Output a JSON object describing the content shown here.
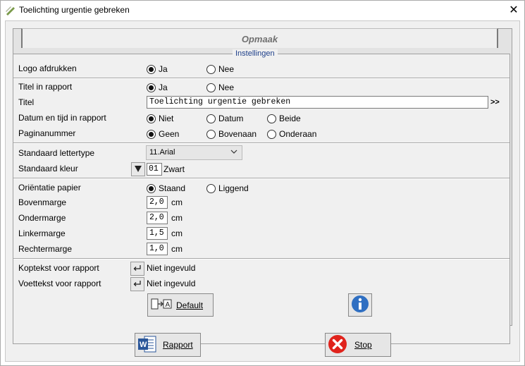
{
  "window": {
    "title": "Toelichting urgentie gebreken",
    "close": "✕"
  },
  "tab": {
    "label": "Opmaak"
  },
  "group": {
    "legend": "Instellingen"
  },
  "logo": {
    "label": "Logo afdrukken",
    "opt1": "Ja",
    "opt2": "Nee",
    "selected": "Ja"
  },
  "title_in_report": {
    "label": "Titel in rapport",
    "opt1": "Ja",
    "opt2": "Nee",
    "selected": "Ja"
  },
  "title": {
    "label": "Titel",
    "value": "Toelichting urgentie gebreken",
    "more": ">>"
  },
  "datetime": {
    "label": "Datum en tijd in rapport",
    "opt1": "Niet",
    "opt2": "Datum",
    "opt3": "Beide",
    "selected": "Niet"
  },
  "pagenum": {
    "label": "Paginanummer",
    "opt1": "Geen",
    "opt2": "Bovenaan",
    "opt3": "Onderaan",
    "selected": "Geen"
  },
  "font": {
    "label": "Standaard lettertype",
    "value": "11.Arial"
  },
  "color": {
    "label": "Standaard kleur",
    "code": "01",
    "name": "Zwart"
  },
  "orientation": {
    "label": "Oriëntatie papier",
    "opt1": "Staand",
    "opt2": "Liggend",
    "selected": "Staand"
  },
  "margins": {
    "unit": "cm",
    "top": {
      "label": "Bovenmarge",
      "value": "2,0"
    },
    "bottom": {
      "label": "Ondermarge",
      "value": "2,0"
    },
    "left": {
      "label": "Linkermarge",
      "value": "1,5"
    },
    "right": {
      "label": "Rechtermarge",
      "value": "1,0"
    }
  },
  "header": {
    "label": "Koptekst voor rapport",
    "value": "Niet ingevuld"
  },
  "footer": {
    "label": "Voettekst voor rapport",
    "value": "Niet ingevuld"
  },
  "buttons": {
    "default": "Default",
    "report": "Rapport",
    "stop": "Stop"
  }
}
